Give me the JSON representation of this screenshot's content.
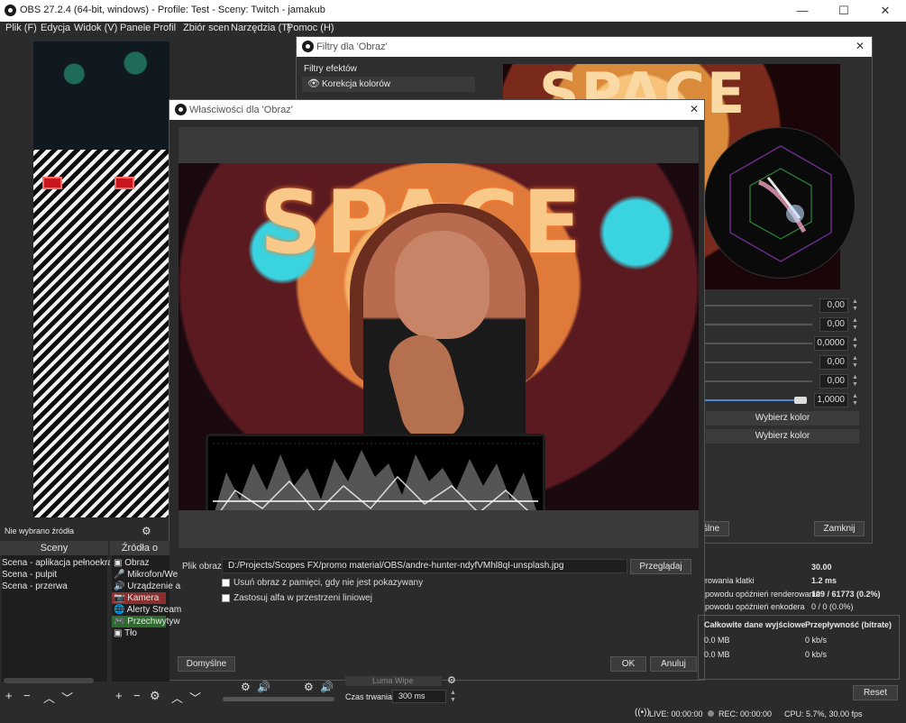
{
  "main_window": {
    "title": "OBS 27.2.4 (64-bit, windows) - Profile: Test - Sceny: Twitch - jamakub",
    "minimize": "—",
    "maximize": "☐",
    "close": "✕"
  },
  "menubar": [
    "Plik (F)",
    "Edycja",
    "Widok (V)",
    "Panele",
    "Profil",
    "Zbiór scen",
    "Narzędzia (T)",
    "Pomoc (H)"
  ],
  "filters_window": {
    "title": "Filtry dla 'Obraz'",
    "effects_label": "Filtry efektów",
    "filter_item": "Korekcja kolorów",
    "values": [
      "0,00",
      "0,00",
      "0,0000",
      "0,00",
      "0,00",
      "1,0000"
    ],
    "pick_color_1": "Wybierz kolor",
    "pick_color_2": "Wybierz kolor",
    "defaults_partial": "ślne",
    "close_button": "Zamknij",
    "preview_text": "SPACE"
  },
  "properties_window": {
    "title": "Właściwości dla 'Obraz'",
    "preview_text": "SPACE",
    "file_label": "Plik obrazu",
    "file_path": "D:/Projects/Scopes FX/promo material/OBS/andre-hunter-ndyfVMhl8qI-unsplash.jpg",
    "browse_button": "Przeglądaj",
    "checkbox_unload": "Usuń obraz z pamięci, gdy nie jest pokazywany",
    "checkbox_alpha": "Zastosuj alfa w przestrzeni liniowej",
    "defaults_button": "Domyślne",
    "ok_button": "OK",
    "cancel_button": "Anuluj"
  },
  "status_no_source": "Nie wybrano źródła",
  "scenes": {
    "title": "Sceny",
    "items": [
      "Scena - aplikacja pełnoekranc",
      "Scena - pulpit",
      "Scena - przerwa"
    ]
  },
  "sources": {
    "title": "Źródła o",
    "items": [
      "Obraz",
      "Mikrofon/We",
      "Urządzenie a",
      "Kamera",
      "Alerty Stream",
      "Przechwytyw",
      "Tło"
    ]
  },
  "transition": {
    "luma_wipe": "Luma Wipe",
    "duration_label": "Czas trwania",
    "duration_value": "300 ms"
  },
  "stats": {
    "fps": "30.00",
    "frame_render_label": "rowania klatki",
    "frame_render_value": "1.2 ms",
    "render_lag_label": "powodu opóźnień renderowania",
    "render_lag_value": "109 / 61773 (0.2%)",
    "encode_lag_label": "powodu opóźnień enkodera",
    "encode_lag_value": "0 / 0 (0.0%)",
    "col_total": "Całkowite dane wyjściowe",
    "col_bitrate": "Przepływność (bitrate)",
    "row1_total": "0.0 MB",
    "row1_bitrate": "0 kb/s",
    "row2_total": "0.0 MB",
    "row2_bitrate": "0 kb/s",
    "reset_button": "Reset"
  },
  "statusbar": {
    "live": "LIVE: 00:00:00",
    "rec": "REC: 00:00:00",
    "cpu": "CPU: 5.7%, 30.00 fps"
  }
}
